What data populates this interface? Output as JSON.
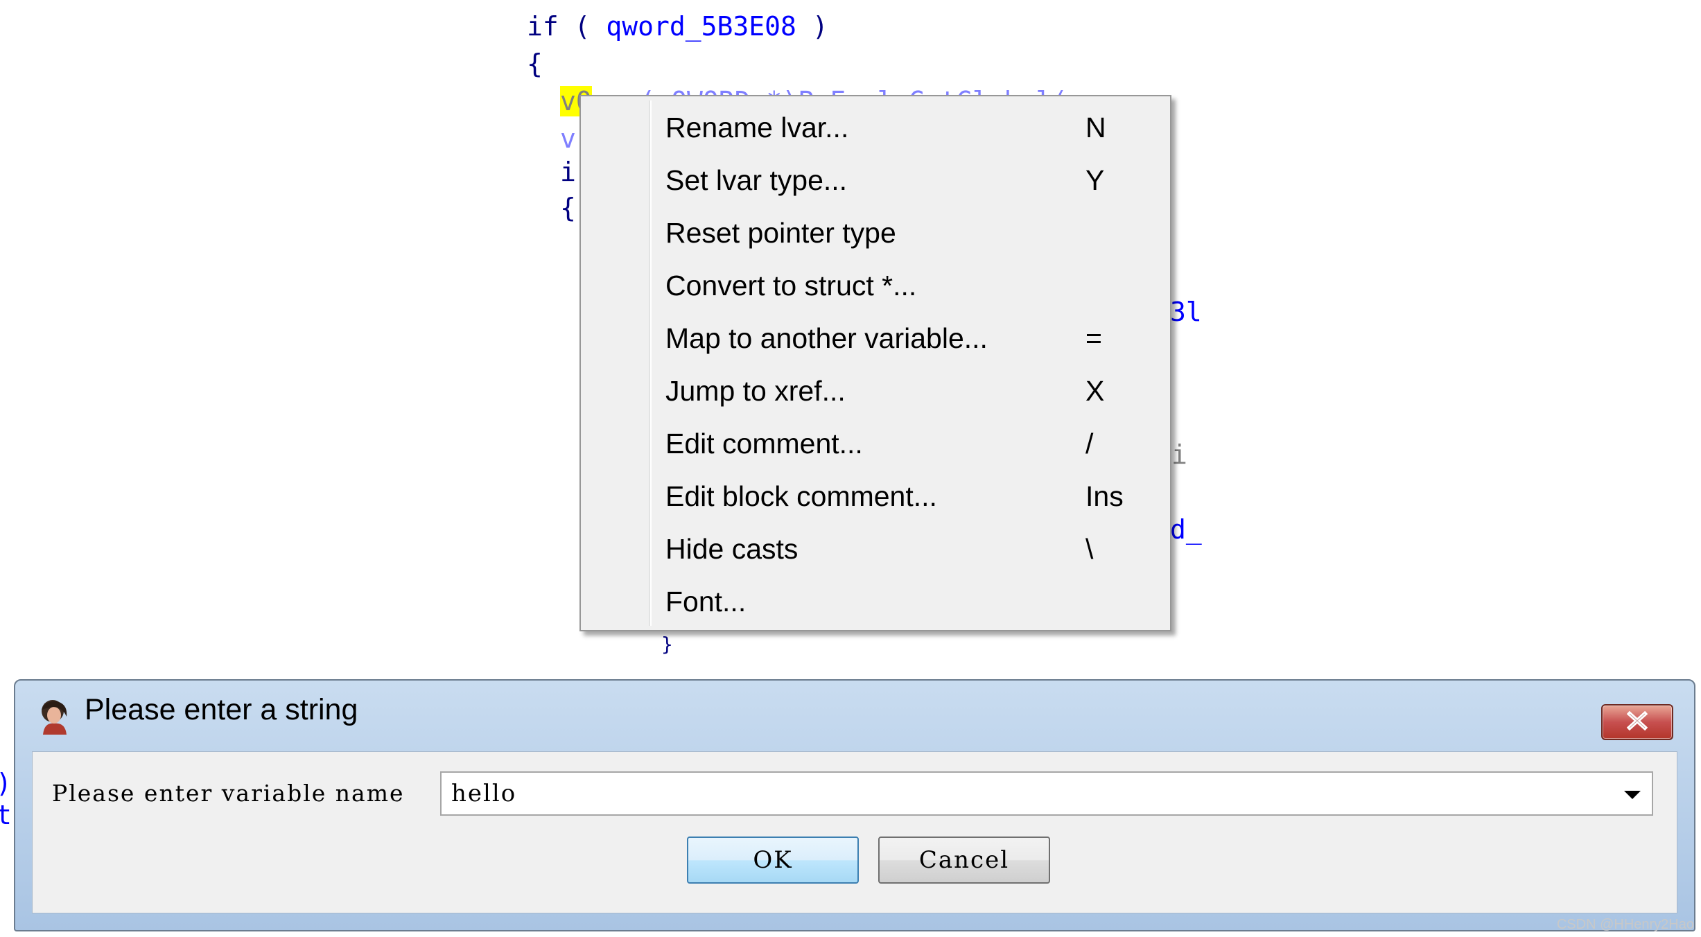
{
  "code": {
    "line1_kw": "if ( ",
    "line1_ident": "qword_5B3E08",
    "line1_end": " )",
    "line2": "{",
    "line3_hl": "v0",
    "line3_rest": " = (_QWORD *)P_FoolsGetGlobal(",
    "line4_start": "v",
    "line5_start": "i",
    "line6_start": "{",
    "frag_right1": "3l",
    "frag_right2": "i",
    "frag_right3": "d_",
    "frag_left1": ")",
    "frag_left2": "t",
    "frag_bottom": "}"
  },
  "context_menu": {
    "items": [
      {
        "label": "Rename lvar...",
        "shortcut": "N"
      },
      {
        "label": "Set lvar type...",
        "shortcut": "Y"
      },
      {
        "label": "Reset pointer type",
        "shortcut": ""
      },
      {
        "label": "Convert to struct *...",
        "shortcut": ""
      },
      {
        "label": "Map to another variable...",
        "shortcut": "="
      },
      {
        "label": "Jump to xref...",
        "shortcut": "X"
      },
      {
        "label": "Edit comment...",
        "shortcut": "/"
      },
      {
        "label": "Edit block comment...",
        "shortcut": "Ins"
      },
      {
        "label": "Hide casts",
        "shortcut": "\\"
      },
      {
        "label": "Font...",
        "shortcut": ""
      }
    ]
  },
  "dialog": {
    "title": "Please enter a string",
    "prompt": "Please enter variable name",
    "input_value": "hello",
    "ok_label": "OK",
    "cancel_label": "Cancel"
  },
  "watermark": "CSDN @HHenry2Hao"
}
